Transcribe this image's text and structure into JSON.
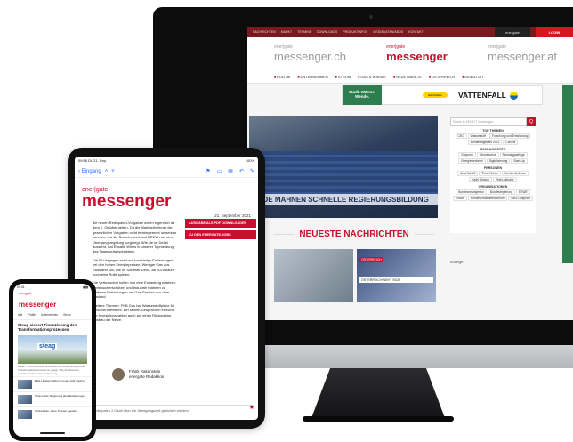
{
  "imac": {
    "topnav": [
      "NACHRICHTEN",
      "MARKT",
      "TERMINE",
      "DOWNLOADS",
      "PRODUKTINFOS",
      "MEDIADATEN/ABOS",
      "KONTAKT"
    ],
    "dark_label": "energate",
    "login_label": "LOGIN",
    "logos": [
      {
        "small": "ener|gate",
        "big": "messenger.ch",
        "active": false
      },
      {
        "small": "ener|gate",
        "big": "messenger",
        "active": true
      },
      {
        "small": "ener|gate",
        "big": "messenger.at",
        "active": false
      }
    ],
    "secnav": [
      "POLITIK",
      "UNTERNEHMEN",
      "STROM",
      "GAS & WÄRME",
      "NEUE MÄRKTE",
      "ÖSTERREICH",
      "MOBILITÄT"
    ],
    "ad": {
      "green_text": "Stadt. Wärme. Wende.",
      "yellow_text": "Mehr Erfahren",
      "brand": "VATTENFALL"
    },
    "hero_caption": "ANDE MAHNEN SCHNELLE REGIERUNGSBILDUNG",
    "news_heading": "NEUESTE NACHRICHTEN",
    "news_tag": "ÖSTERREICH",
    "news_snippet": "ÖSTERREICH NEHT SICH",
    "sidebar": {
      "search_placeholder": "Suche in 155.317 Meldungen",
      "search_btn": "Q",
      "top_themes_title": "TOP THEMEN",
      "top_themes": [
        "CEO",
        "Wasserstoff",
        "Forschung und Entwicklung",
        "Bundestagswahl 2021",
        "Corona"
      ],
      "keywords_title": "SCHLAGWORTE",
      "keywords": [
        "Gazprom",
        "Stromboerse",
        "Fluessiggasfrage",
        "Energiewerkesel",
        "Digitalisierung",
        "Start-Up"
      ],
      "people_title": "PERSONEN",
      "people": [
        "Anja Schüß",
        "Timm Nehrer",
        "Kerstin Andreae",
        "Kadri Simson",
        "Peter Altmaier"
      ],
      "orgs_title": "ORGANISATIONEN",
      "orgs": [
        "Bundesnetzagentur",
        "Bundesregierung",
        "EEWE",
        "ENBW",
        "Bundesumweltministerium",
        "GAS Gazprom"
      ]
    },
    "anzeige": "Anzeige"
  },
  "ipad": {
    "status_time": "09:56 Di. 21. Sep.",
    "status_right": "100%",
    "back_label": "Eingang",
    "date": "21. September 2021",
    "logo_small": "ener|gate",
    "logo_big": "messenger",
    "paragraphs": [
      "die neuen Redispatch-Vorgaben sollen eigentlich ab dem 1. Oktober gelten. Da die Marktteilnehmer die gesetzlichen Vorgaben nicht termingerecht umsetzen konnten, hat die Branchenverband BDEW nun eine Übergangsregelung vorgelegt. Wie sie im Detail aussieht, hat Rosalie Wilms in unserer Topmeldung des Tages aufgeschrieben.",
      "Die EU dagegen setzt auf kurzfristige Entlastungen bei den hohen Energiepreisen. Weniger Gas aus Russland soll, wie im Sommer Dena, ab 2025 kaum noch eine Rolle spielen.",
      "Die Verbraucher sollen nun eine Entlastung erfahren. Verbraucherschützer und Industrie mahnen zu weiteren Entlastungen an. Gas-Staaten aus dem Ausland.",
      "Weitere Themen: FNB Gas hat Wasserstoffpläne für 2050 veröffentlicht. Bei seinen Gesprächen erreicht der Investitionszahlen auch auf einen Rückschlag, Ausbau der Netze."
    ],
    "btn_pdf": "AUSGABE ALS PDF DOWNLOADEN",
    "btn_energate": "ZU DEN ENERGATE-JOBS",
    "sign_name": "Frank Rakenstein",
    "sign_role": "energate Redaktion",
    "footer": "Redispatch 2.0 soll über die Übergangszeit gesichert werden"
  },
  "iphone": {
    "status_time": "09:41",
    "logo_small": "ener|gate",
    "logo_big": "messenger",
    "tabs": [
      "Alle",
      "Politik",
      "Unternehmen",
      "Strom"
    ],
    "title": "Steag sichert Finanzierung des Transformationsprozesses",
    "img_label": "steag",
    "summary": "Essen - Der finanzielle Grundstein für einen erfolgreichen Transformationsprozess ist gelegt. Wie der Konzern mitteilte, steht die Neuaufstellung.",
    "items": [
      "EEG-Umlage bleibt im neuen Jahr niedrig",
      "Strommarkt: Regierung plant Entlastungen",
      "Netzausbau: Neue Trassen geplant"
    ]
  }
}
